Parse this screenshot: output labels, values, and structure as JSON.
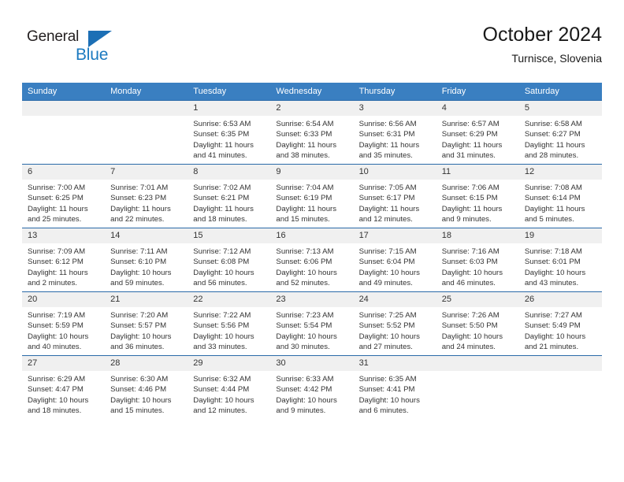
{
  "brand": {
    "name_top": "General",
    "name_bottom": "Blue",
    "accent_color": "#1c7ac0",
    "triangle_color": "#1c6fb5"
  },
  "header": {
    "title": "October 2024",
    "subtitle": "Turnisce, Slovenia"
  },
  "colors": {
    "header_row_bg": "#3a7fc1",
    "header_row_text": "#ffffff",
    "daynum_bg": "#f0f0f0",
    "row_divider": "#2a6aa8",
    "body_text": "#333333"
  },
  "weekday_headers": [
    "Sunday",
    "Monday",
    "Tuesday",
    "Wednesday",
    "Thursday",
    "Friday",
    "Saturday"
  ],
  "labels": {
    "sunrise": "Sunrise:",
    "sunset": "Sunset:",
    "daylight": "Daylight:"
  },
  "weeks": [
    [
      {
        "day": "",
        "empty": true
      },
      {
        "day": "",
        "empty": true
      },
      {
        "day": "1",
        "sunrise": "Sunrise: 6:53 AM",
        "sunset": "Sunset: 6:35 PM",
        "daylight_1": "Daylight: 11 hours",
        "daylight_2": "and 41 minutes."
      },
      {
        "day": "2",
        "sunrise": "Sunrise: 6:54 AM",
        "sunset": "Sunset: 6:33 PM",
        "daylight_1": "Daylight: 11 hours",
        "daylight_2": "and 38 minutes."
      },
      {
        "day": "3",
        "sunrise": "Sunrise: 6:56 AM",
        "sunset": "Sunset: 6:31 PM",
        "daylight_1": "Daylight: 11 hours",
        "daylight_2": "and 35 minutes."
      },
      {
        "day": "4",
        "sunrise": "Sunrise: 6:57 AM",
        "sunset": "Sunset: 6:29 PM",
        "daylight_1": "Daylight: 11 hours",
        "daylight_2": "and 31 minutes."
      },
      {
        "day": "5",
        "sunrise": "Sunrise: 6:58 AM",
        "sunset": "Sunset: 6:27 PM",
        "daylight_1": "Daylight: 11 hours",
        "daylight_2": "and 28 minutes."
      }
    ],
    [
      {
        "day": "6",
        "sunrise": "Sunrise: 7:00 AM",
        "sunset": "Sunset: 6:25 PM",
        "daylight_1": "Daylight: 11 hours",
        "daylight_2": "and 25 minutes."
      },
      {
        "day": "7",
        "sunrise": "Sunrise: 7:01 AM",
        "sunset": "Sunset: 6:23 PM",
        "daylight_1": "Daylight: 11 hours",
        "daylight_2": "and 22 minutes."
      },
      {
        "day": "8",
        "sunrise": "Sunrise: 7:02 AM",
        "sunset": "Sunset: 6:21 PM",
        "daylight_1": "Daylight: 11 hours",
        "daylight_2": "and 18 minutes."
      },
      {
        "day": "9",
        "sunrise": "Sunrise: 7:04 AM",
        "sunset": "Sunset: 6:19 PM",
        "daylight_1": "Daylight: 11 hours",
        "daylight_2": "and 15 minutes."
      },
      {
        "day": "10",
        "sunrise": "Sunrise: 7:05 AM",
        "sunset": "Sunset: 6:17 PM",
        "daylight_1": "Daylight: 11 hours",
        "daylight_2": "and 12 minutes."
      },
      {
        "day": "11",
        "sunrise": "Sunrise: 7:06 AM",
        "sunset": "Sunset: 6:15 PM",
        "daylight_1": "Daylight: 11 hours",
        "daylight_2": "and 9 minutes."
      },
      {
        "day": "12",
        "sunrise": "Sunrise: 7:08 AM",
        "sunset": "Sunset: 6:14 PM",
        "daylight_1": "Daylight: 11 hours",
        "daylight_2": "and 5 minutes."
      }
    ],
    [
      {
        "day": "13",
        "sunrise": "Sunrise: 7:09 AM",
        "sunset": "Sunset: 6:12 PM",
        "daylight_1": "Daylight: 11 hours",
        "daylight_2": "and 2 minutes."
      },
      {
        "day": "14",
        "sunrise": "Sunrise: 7:11 AM",
        "sunset": "Sunset: 6:10 PM",
        "daylight_1": "Daylight: 10 hours",
        "daylight_2": "and 59 minutes."
      },
      {
        "day": "15",
        "sunrise": "Sunrise: 7:12 AM",
        "sunset": "Sunset: 6:08 PM",
        "daylight_1": "Daylight: 10 hours",
        "daylight_2": "and 56 minutes."
      },
      {
        "day": "16",
        "sunrise": "Sunrise: 7:13 AM",
        "sunset": "Sunset: 6:06 PM",
        "daylight_1": "Daylight: 10 hours",
        "daylight_2": "and 52 minutes."
      },
      {
        "day": "17",
        "sunrise": "Sunrise: 7:15 AM",
        "sunset": "Sunset: 6:04 PM",
        "daylight_1": "Daylight: 10 hours",
        "daylight_2": "and 49 minutes."
      },
      {
        "day": "18",
        "sunrise": "Sunrise: 7:16 AM",
        "sunset": "Sunset: 6:03 PM",
        "daylight_1": "Daylight: 10 hours",
        "daylight_2": "and 46 minutes."
      },
      {
        "day": "19",
        "sunrise": "Sunrise: 7:18 AM",
        "sunset": "Sunset: 6:01 PM",
        "daylight_1": "Daylight: 10 hours",
        "daylight_2": "and 43 minutes."
      }
    ],
    [
      {
        "day": "20",
        "sunrise": "Sunrise: 7:19 AM",
        "sunset": "Sunset: 5:59 PM",
        "daylight_1": "Daylight: 10 hours",
        "daylight_2": "and 40 minutes."
      },
      {
        "day": "21",
        "sunrise": "Sunrise: 7:20 AM",
        "sunset": "Sunset: 5:57 PM",
        "daylight_1": "Daylight: 10 hours",
        "daylight_2": "and 36 minutes."
      },
      {
        "day": "22",
        "sunrise": "Sunrise: 7:22 AM",
        "sunset": "Sunset: 5:56 PM",
        "daylight_1": "Daylight: 10 hours",
        "daylight_2": "and 33 minutes."
      },
      {
        "day": "23",
        "sunrise": "Sunrise: 7:23 AM",
        "sunset": "Sunset: 5:54 PM",
        "daylight_1": "Daylight: 10 hours",
        "daylight_2": "and 30 minutes."
      },
      {
        "day": "24",
        "sunrise": "Sunrise: 7:25 AM",
        "sunset": "Sunset: 5:52 PM",
        "daylight_1": "Daylight: 10 hours",
        "daylight_2": "and 27 minutes."
      },
      {
        "day": "25",
        "sunrise": "Sunrise: 7:26 AM",
        "sunset": "Sunset: 5:50 PM",
        "daylight_1": "Daylight: 10 hours",
        "daylight_2": "and 24 minutes."
      },
      {
        "day": "26",
        "sunrise": "Sunrise: 7:27 AM",
        "sunset": "Sunset: 5:49 PM",
        "daylight_1": "Daylight: 10 hours",
        "daylight_2": "and 21 minutes."
      }
    ],
    [
      {
        "day": "27",
        "sunrise": "Sunrise: 6:29 AM",
        "sunset": "Sunset: 4:47 PM",
        "daylight_1": "Daylight: 10 hours",
        "daylight_2": "and 18 minutes."
      },
      {
        "day": "28",
        "sunrise": "Sunrise: 6:30 AM",
        "sunset": "Sunset: 4:46 PM",
        "daylight_1": "Daylight: 10 hours",
        "daylight_2": "and 15 minutes."
      },
      {
        "day": "29",
        "sunrise": "Sunrise: 6:32 AM",
        "sunset": "Sunset: 4:44 PM",
        "daylight_1": "Daylight: 10 hours",
        "daylight_2": "and 12 minutes."
      },
      {
        "day": "30",
        "sunrise": "Sunrise: 6:33 AM",
        "sunset": "Sunset: 4:42 PM",
        "daylight_1": "Daylight: 10 hours",
        "daylight_2": "and 9 minutes."
      },
      {
        "day": "31",
        "sunrise": "Sunrise: 6:35 AM",
        "sunset": "Sunset: 4:41 PM",
        "daylight_1": "Daylight: 10 hours",
        "daylight_2": "and 6 minutes."
      },
      {
        "day": "",
        "empty": true
      },
      {
        "day": "",
        "empty": true
      }
    ]
  ]
}
